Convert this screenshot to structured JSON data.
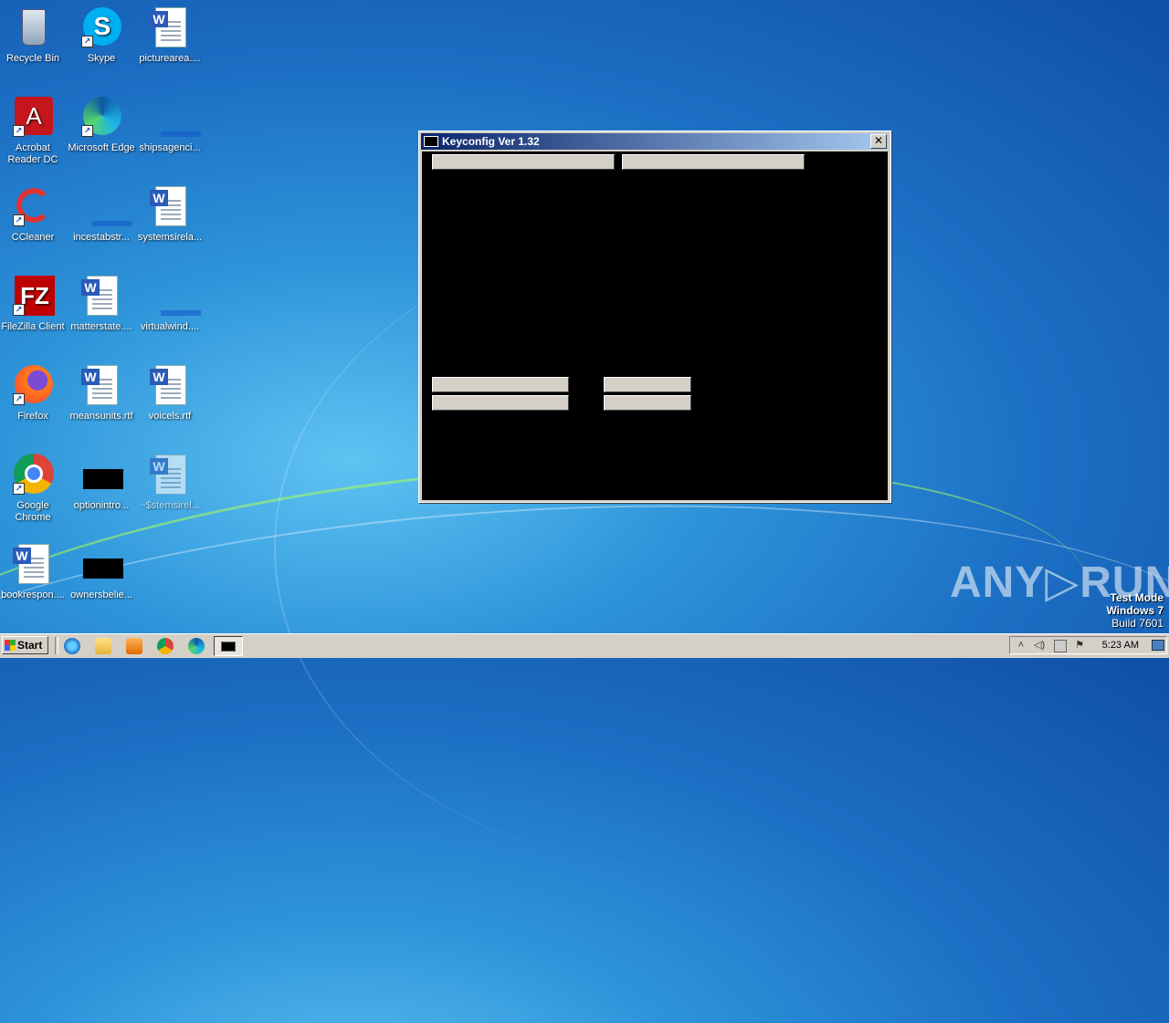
{
  "desktop": {
    "icons": [
      {
        "label": "Recycle Bin"
      },
      {
        "label": "Skype"
      },
      {
        "label": "picturearea...."
      },
      {
        "label": "Acrobat Reader DC"
      },
      {
        "label": "Microsoft Edge"
      },
      {
        "label": "shipsagenci..."
      },
      {
        "label": "CCleaner"
      },
      {
        "label": "incestabstr..."
      },
      {
        "label": "systemsirela..."
      },
      {
        "label": "FileZilla Client"
      },
      {
        "label": "matterstate...."
      },
      {
        "label": "virtualwind...."
      },
      {
        "label": "Firefox"
      },
      {
        "label": "meansunits.rtf"
      },
      {
        "label": "voicels.rtf"
      },
      {
        "label": "Google Chrome"
      },
      {
        "label": "optionintro..."
      },
      {
        "label": "~$stemsirel..."
      },
      {
        "label": "bookrespon...."
      },
      {
        "label": "ownersbelie..."
      }
    ]
  },
  "window": {
    "title": "Keyconfig Ver 1.32",
    "close_label": "✕"
  },
  "watermark": {
    "text": "ANY▷RUN"
  },
  "os_info": {
    "line1": "Test Mode",
    "line2": "Windows 7",
    "line3": "Build 7601"
  },
  "taskbar": {
    "start_label": "Start",
    "clock": "5:23 AM"
  },
  "colors": {
    "titlebar": "#0a246a",
    "desktop": "#1c6fc4"
  }
}
